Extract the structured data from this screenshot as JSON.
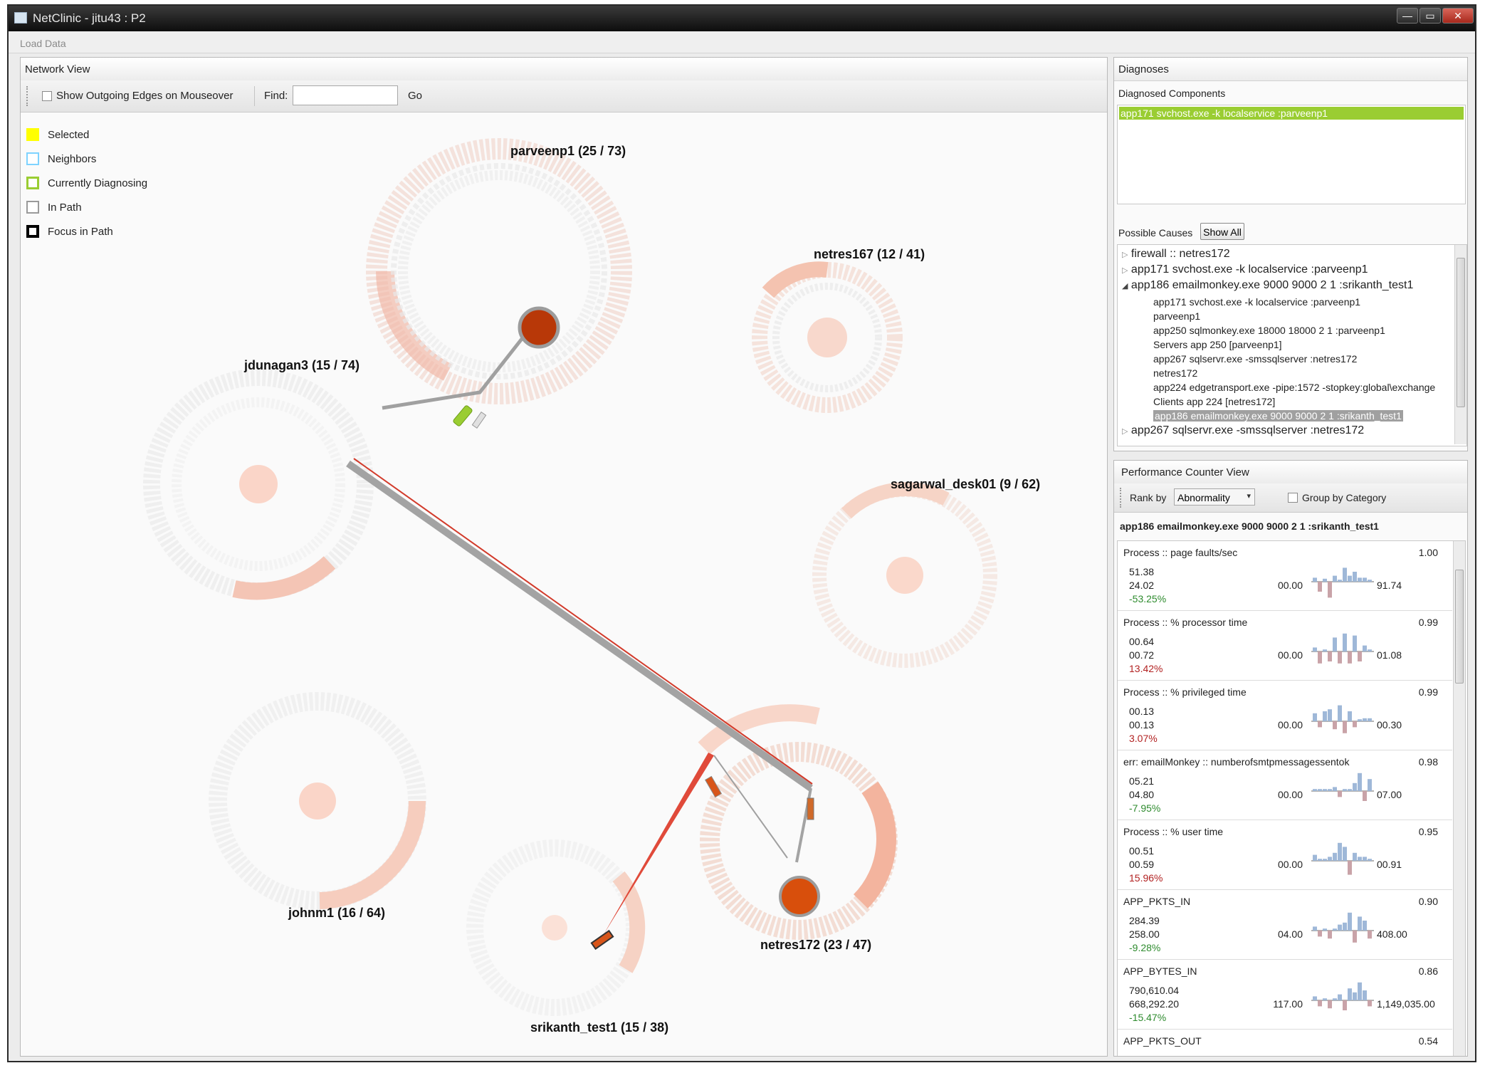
{
  "window": {
    "title": "NetClinic - jitu43 : P2",
    "buttons": [
      "—",
      "▭",
      "✕"
    ]
  },
  "menu": {
    "load_data": "Load Data"
  },
  "network_view": {
    "title": "Network View",
    "show_edges_label": "Show Outgoing Edges on Mouseover",
    "find_label": "Find:",
    "find_value": "",
    "go_label": "Go",
    "legend": [
      {
        "label": "Selected",
        "color": "#ffff00"
      },
      {
        "label": "Neighbors",
        "color": "#7fd3ff"
      },
      {
        "label": "Currently Diagnosing",
        "color": "#9acd32"
      },
      {
        "label": "In Path",
        "color": "#9a9a9a"
      },
      {
        "label": "Focus in Path",
        "color": "#000000"
      }
    ],
    "nodes": [
      {
        "label": "parveenp1 (25 / 73)"
      },
      {
        "label": "netres167 (12 / 41)"
      },
      {
        "label": "jdunagan3 (15 / 74)"
      },
      {
        "label": "sagarwal_desk01 (9 / 62)"
      },
      {
        "label": "johnm1 (16 / 64)"
      },
      {
        "label": "netres172 (23 / 47)"
      },
      {
        "label": "srikanth_test1 (15 / 38)"
      }
    ]
  },
  "diagnoses": {
    "title": "Diagnoses",
    "components_label": "Diagnosed Components",
    "components": [
      "app171 svchost.exe -k localservice :parveenp1"
    ],
    "possible_causes_label": "Possible Causes",
    "show_all_label": "Show All",
    "tree": [
      {
        "label": "firewall :: netres172",
        "expanded": false,
        "arrow": "▷"
      },
      {
        "label": "app171 svchost.exe -k localservice :parveenp1",
        "expanded": false,
        "arrow": "▷"
      },
      {
        "label": "app186 emailmonkey.exe  9000 9000 2 1 :srikanth_test1",
        "expanded": true,
        "arrow": "◢"
      },
      {
        "label": "app267 sqlservr.exe  -smssqlserver :netres172",
        "expanded": false,
        "arrow": "▷"
      }
    ],
    "tree_children": [
      "app171 svchost.exe -k localservice :parveenp1",
      "parveenp1",
      "app250 sqlmonkey.exe  18000 18000 2 1 :parveenp1",
      "Servers app 250 [parveenp1]",
      "app267 sqlservr.exe  -smssqlserver :netres172",
      "netres172",
      "app224 edgetransport.exe  -pipe:1572 -stopkey:global\\exchange",
      "Clients app 224 [netres172]",
      "app186 emailmonkey.exe  9000 9000 2 1 :srikanth_test1"
    ],
    "selected_child_index": 8
  },
  "perf": {
    "title": "Performance Counter View",
    "rank_by_label": "Rank by",
    "rank_by_value": "Abnormality",
    "group_label": "Group by Category",
    "component": "app186 emailmonkey.exe  9000 9000 2 1 :srikanth_test1",
    "counters": [
      {
        "name": "Process :: page faults/sec",
        "score": "1.00",
        "v1": "51.38",
        "v2": "24.02",
        "pct": "-53.25%",
        "pct_color": "#2e8b2e",
        "min": "00.00",
        "max": "91.74",
        "bars": [
          0.2,
          -0.5,
          0.15,
          -0.8,
          0.3,
          0.1,
          0.7,
          0.3,
          0.5,
          0.2,
          0.2,
          0.1
        ]
      },
      {
        "name": "Process :: % processor time",
        "score": "0.99",
        "v1": "00.64",
        "v2": "00.72",
        "pct": "13.42%",
        "pct_color": "#b22222",
        "min": "00.00",
        "max": "01.08",
        "bars": [
          0.2,
          -0.6,
          0.1,
          -0.5,
          0.7,
          -0.6,
          0.9,
          -0.6,
          0.8,
          -0.5,
          0.3,
          0.1
        ]
      },
      {
        "name": "Process :: % privileged time",
        "score": "0.99",
        "v1": "00.13",
        "v2": "00.13",
        "pct": "3.07%",
        "pct_color": "#b22222",
        "min": "00.00",
        "max": "00.30",
        "bars": [
          0.4,
          -0.3,
          0.5,
          0.6,
          -0.4,
          0.8,
          -0.6,
          0.5,
          -0.3,
          0.1,
          0.15,
          0.15
        ]
      },
      {
        "name": "err: emailMonkey :: numberofsmtpmessagessentok",
        "score": "0.98",
        "v1": "05.21",
        "v2": "04.80",
        "pct": "-7.95%",
        "pct_color": "#2e8b2e",
        "min": "00.00",
        "max": "07.00",
        "bars": [
          0.1,
          0.1,
          0.1,
          0.1,
          0.2,
          -0.3,
          0.1,
          0.1,
          0.4,
          0.9,
          -0.5,
          0.6
        ]
      },
      {
        "name": "Process :: % user time",
        "score": "0.95",
        "v1": "00.51",
        "v2": "00.59",
        "pct": "15.96%",
        "pct_color": "#b22222",
        "min": "00.00",
        "max": "00.91",
        "bars": [
          0.3,
          0.1,
          0.1,
          0.2,
          0.4,
          0.9,
          0.7,
          -0.7,
          0.4,
          0.2,
          0.2,
          0.1
        ]
      },
      {
        "name": "APP_PKTS_IN",
        "score": "0.90",
        "v1": "284.39",
        "v2": "258.00",
        "pct": "-9.28%",
        "pct_color": "#2e8b2e",
        "min": "04.00",
        "max": "408.00",
        "bars": [
          0.2,
          -0.3,
          0.1,
          -0.4,
          0.1,
          0.3,
          0.4,
          0.9,
          -0.6,
          0.7,
          0.5,
          -0.4
        ]
      },
      {
        "name": "APP_BYTES_IN",
        "score": "0.86",
        "v1": "790,610.04",
        "v2": "668,292.20",
        "pct": "-15.47%",
        "pct_color": "#2e8b2e",
        "min": "117.00",
        "max": "1,149,035.00",
        "bars": [
          0.2,
          -0.3,
          0.1,
          -0.4,
          0.1,
          0.3,
          -0.5,
          0.6,
          0.4,
          0.9,
          0.5,
          -0.3
        ]
      },
      {
        "name": "APP_PKTS_OUT",
        "score": "0.54"
      }
    ]
  }
}
